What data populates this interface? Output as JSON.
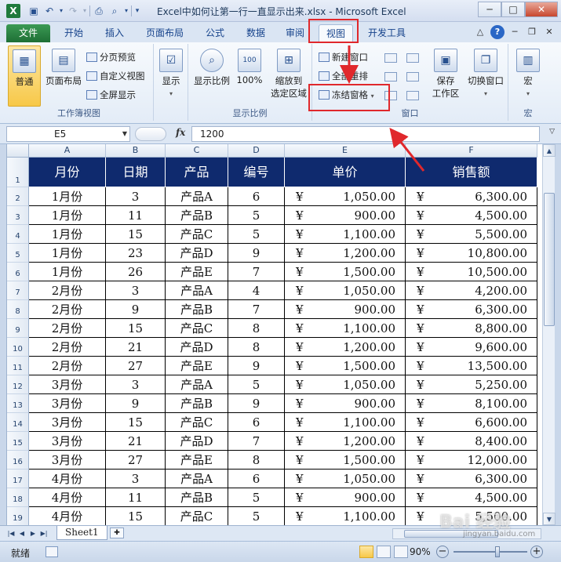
{
  "window": {
    "title": "Excel中如何让第一行一直显示出来.xlsx - Microsoft Excel",
    "app_icon": "X",
    "controls": {
      "minimize": "─",
      "maximize": "□",
      "close": "✕"
    }
  },
  "tabs": {
    "file": "文件",
    "items": [
      "开始",
      "插入",
      "页面布局",
      "公式",
      "数据",
      "审阅",
      "视图",
      "开发工具"
    ],
    "active": "视图"
  },
  "ribbon": {
    "workbook_views": {
      "label": "工作簿视图",
      "normal": "普通",
      "page_layout": "页面布局",
      "page_break": "分页预览",
      "custom_views": "自定义视图",
      "full_screen": "全屏显示"
    },
    "show": {
      "label": "显示"
    },
    "zoom": {
      "label": "显示比例",
      "zoom": "显示比例",
      "hundred": "100%",
      "hundred_icon": "100",
      "zoom_selection_line1": "缩放到",
      "zoom_selection_line2": "选定区域"
    },
    "window": {
      "label": "窗口",
      "new_window": "新建窗口",
      "arrange_all": "全部重排",
      "freeze_panes": "冻结窗格",
      "save_workspace_line1": "保存",
      "save_workspace_line2": "工作区",
      "switch_windows": "切换窗口"
    },
    "macros": {
      "label": "宏",
      "macros": "宏"
    }
  },
  "formula_bar": {
    "name_box": "E5",
    "fx": "fx",
    "value": "1200"
  },
  "grid": {
    "columns": [
      "A",
      "B",
      "C",
      "D",
      "E",
      "F"
    ],
    "row_numbers": [
      "1",
      "2",
      "3",
      "4",
      "5",
      "6",
      "7",
      "8",
      "9",
      "10",
      "11",
      "12",
      "13",
      "14",
      "15",
      "16",
      "17",
      "18",
      "19"
    ],
    "header": [
      "月份",
      "日期",
      "产品",
      "编号",
      "单价",
      "销售额"
    ],
    "currency": "¥",
    "rows": [
      [
        "1月份",
        "3",
        "产品A",
        "6",
        "1,050.00",
        "6,300.00"
      ],
      [
        "1月份",
        "11",
        "产品B",
        "5",
        "900.00",
        "4,500.00"
      ],
      [
        "1月份",
        "15",
        "产品C",
        "5",
        "1,100.00",
        "5,500.00"
      ],
      [
        "1月份",
        "23",
        "产品D",
        "9",
        "1,200.00",
        "10,800.00"
      ],
      [
        "1月份",
        "26",
        "产品E",
        "7",
        "1,500.00",
        "10,500.00"
      ],
      [
        "2月份",
        "3",
        "产品A",
        "4",
        "1,050.00",
        "4,200.00"
      ],
      [
        "2月份",
        "9",
        "产品B",
        "7",
        "900.00",
        "6,300.00"
      ],
      [
        "2月份",
        "15",
        "产品C",
        "8",
        "1,100.00",
        "8,800.00"
      ],
      [
        "2月份",
        "21",
        "产品D",
        "8",
        "1,200.00",
        "9,600.00"
      ],
      [
        "2月份",
        "27",
        "产品E",
        "9",
        "1,500.00",
        "13,500.00"
      ],
      [
        "3月份",
        "3",
        "产品A",
        "5",
        "1,050.00",
        "5,250.00"
      ],
      [
        "3月份",
        "9",
        "产品B",
        "9",
        "900.00",
        "8,100.00"
      ],
      [
        "3月份",
        "15",
        "产品C",
        "6",
        "1,100.00",
        "6,600.00"
      ],
      [
        "3月份",
        "21",
        "产品D",
        "7",
        "1,200.00",
        "8,400.00"
      ],
      [
        "3月份",
        "27",
        "产品E",
        "8",
        "1,500.00",
        "12,000.00"
      ],
      [
        "4月份",
        "3",
        "产品A",
        "6",
        "1,050.00",
        "6,300.00"
      ],
      [
        "4月份",
        "11",
        "产品B",
        "5",
        "900.00",
        "4,500.00"
      ],
      [
        "4月份",
        "15",
        "产品C",
        "5",
        "1,100.00",
        "5,500.00"
      ]
    ]
  },
  "sheet_bar": {
    "sheet_tab": "Sheet1"
  },
  "status_bar": {
    "ready": "就绪",
    "zoom": "90%",
    "zoom_fraction": 0.6
  },
  "watermark": {
    "text": "Bai 经验",
    "url": "jingyan.baidu.com"
  },
  "colors": {
    "header_fill": "#0f2a6e",
    "annotation_red": "#e0282c",
    "file_tab": "#1e6f35"
  }
}
